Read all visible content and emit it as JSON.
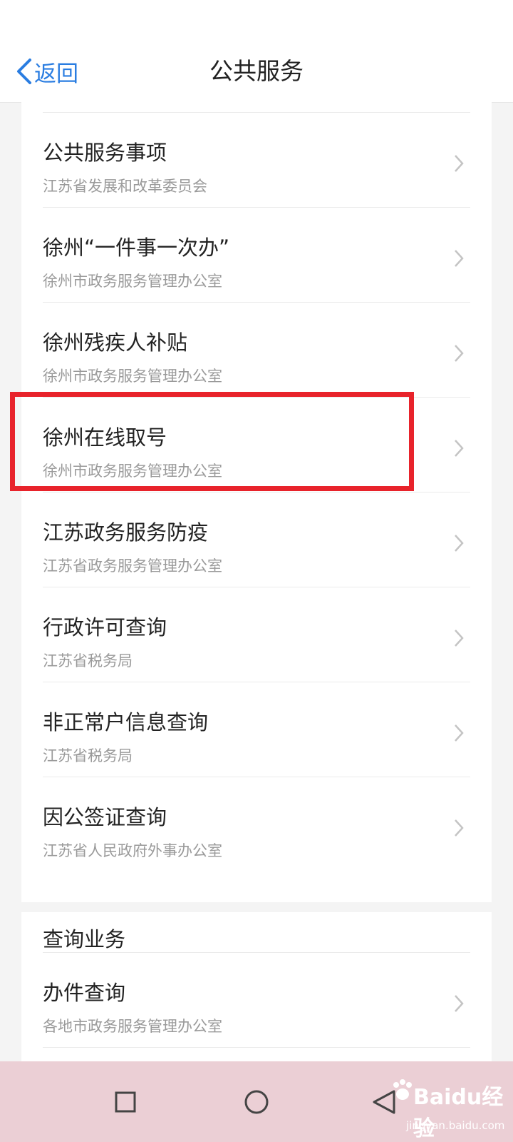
{
  "header": {
    "back_label": "返回",
    "title": "公共服务"
  },
  "services": [
    {
      "title": "公共服务事项",
      "subtitle": "江苏省发展和改革委员会"
    },
    {
      "title": "徐州“一件事一次办”",
      "subtitle": "徐州市政务服务管理办公室"
    },
    {
      "title": "徐州残疾人补贴",
      "subtitle": "徐州市政务服务管理办公室"
    },
    {
      "title": "徐州在线取号",
      "subtitle": "徐州市政务服务管理办公室"
    },
    {
      "title": "江苏政务服务防疫",
      "subtitle": "江苏省政务服务管理办公室"
    },
    {
      "title": "行政许可查询",
      "subtitle": "江苏省税务局"
    },
    {
      "title": "非正常户信息查询",
      "subtitle": "江苏省税务局"
    },
    {
      "title": "因公签证查询",
      "subtitle": "江苏省人民政府外事办公室"
    }
  ],
  "query_section": {
    "title": "查询业务",
    "items": [
      {
        "title": "办件查询",
        "subtitle": "各地市政务服务管理办公室"
      }
    ]
  },
  "highlighted_item": "徐州在线取号",
  "nav": {
    "buttons": [
      "recent-apps-icon",
      "home-icon",
      "back-nav-icon"
    ]
  },
  "watermark": {
    "brand": "Baidu经验",
    "sub": "jingyan.baidu.com"
  },
  "colors": {
    "accent": "#2a7de1",
    "highlight_border": "#e8232b",
    "navbar": "#ebcfd5",
    "subtitle": "#9a9a9a"
  }
}
